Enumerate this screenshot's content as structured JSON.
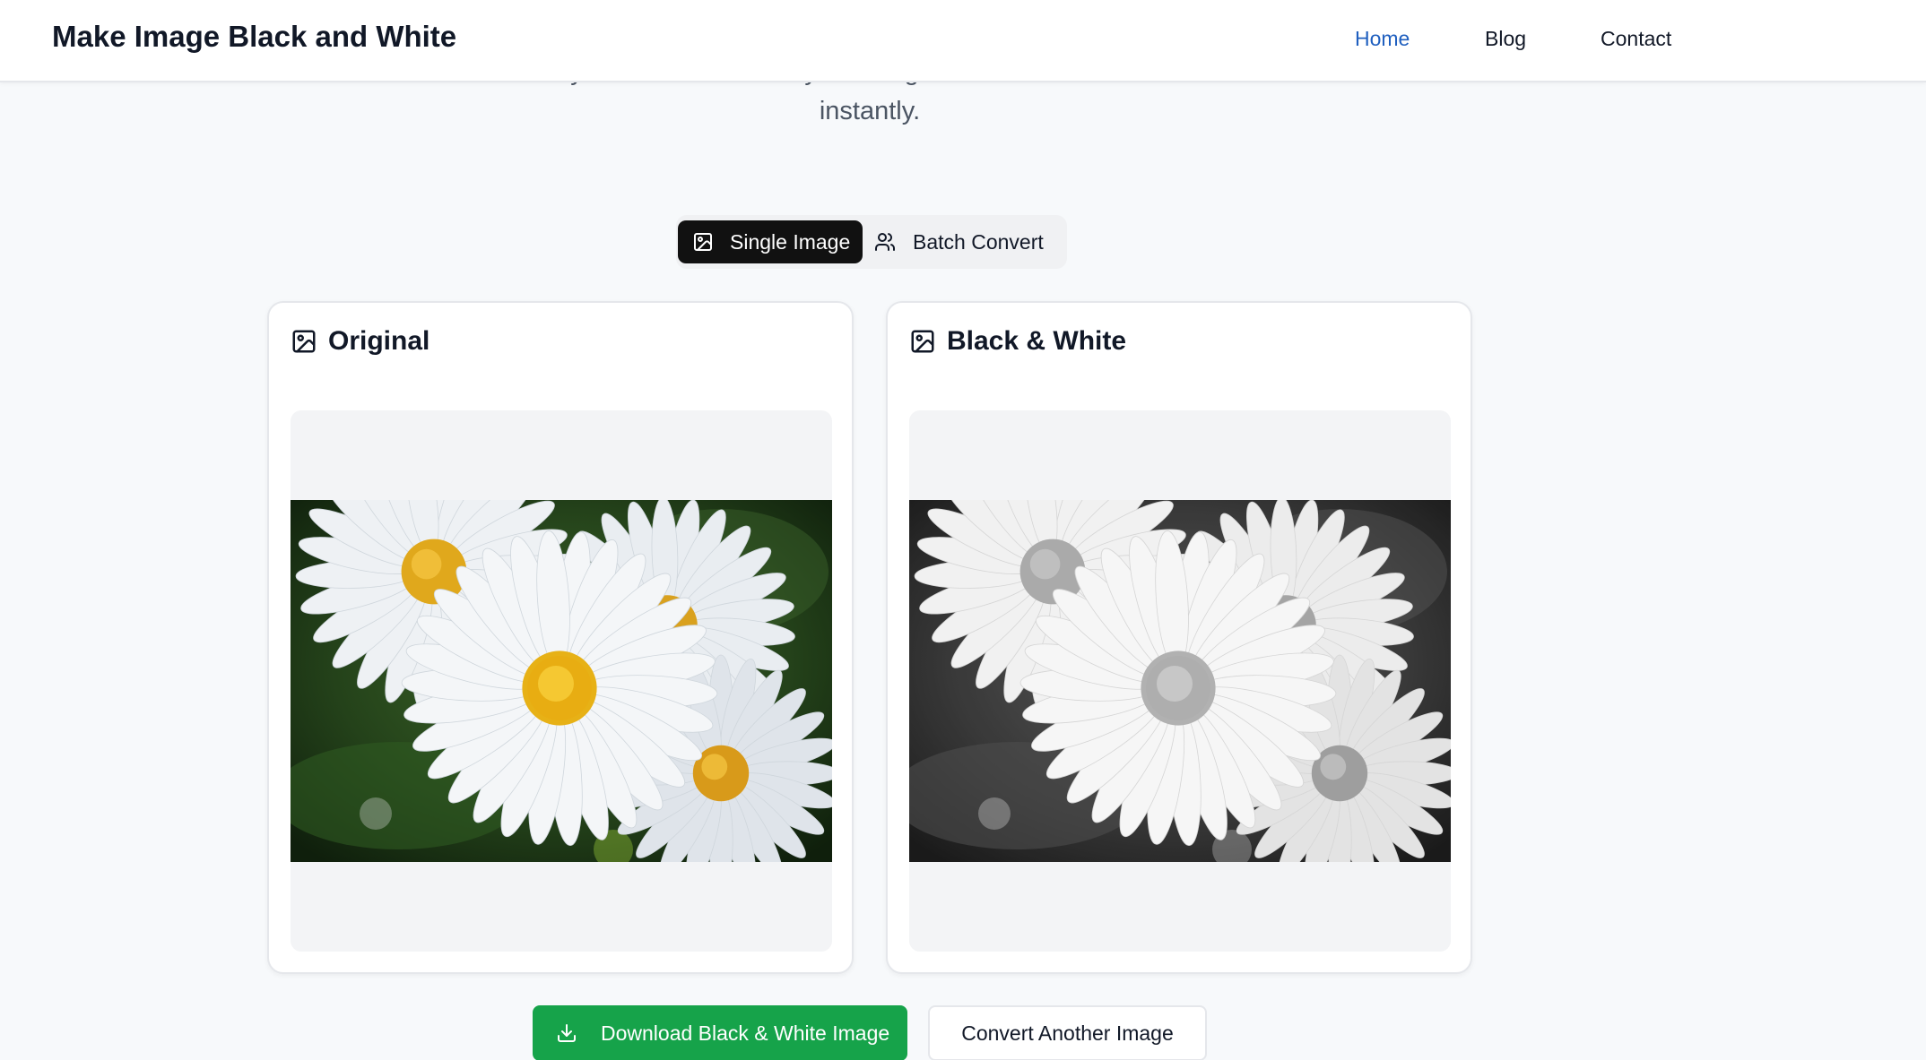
{
  "header": {
    "brand": "Make Image Black and White",
    "nav": [
      {
        "label": "Home",
        "active": true
      },
      {
        "label": "Blog",
        "active": false
      },
      {
        "label": "Contact",
        "active": false
      }
    ]
  },
  "intro": {
    "text": "instant results in your browser. Make your image black and white now and download it instantly."
  },
  "tabs": {
    "single_label": "Single Image",
    "batch_label": "Batch Convert",
    "active": "Single Image"
  },
  "cards": {
    "original_title": "Original",
    "bw_title": "Black & White"
  },
  "actions": {
    "download_label": "Download Black & White Image",
    "convert_label": "Convert Another Image"
  },
  "colors": {
    "accent_link": "#1f5fbf",
    "download_green": "#16a34a",
    "active_tab_bg": "#111111"
  },
  "icons": [
    "image-icon",
    "users-icon",
    "download-icon"
  ]
}
